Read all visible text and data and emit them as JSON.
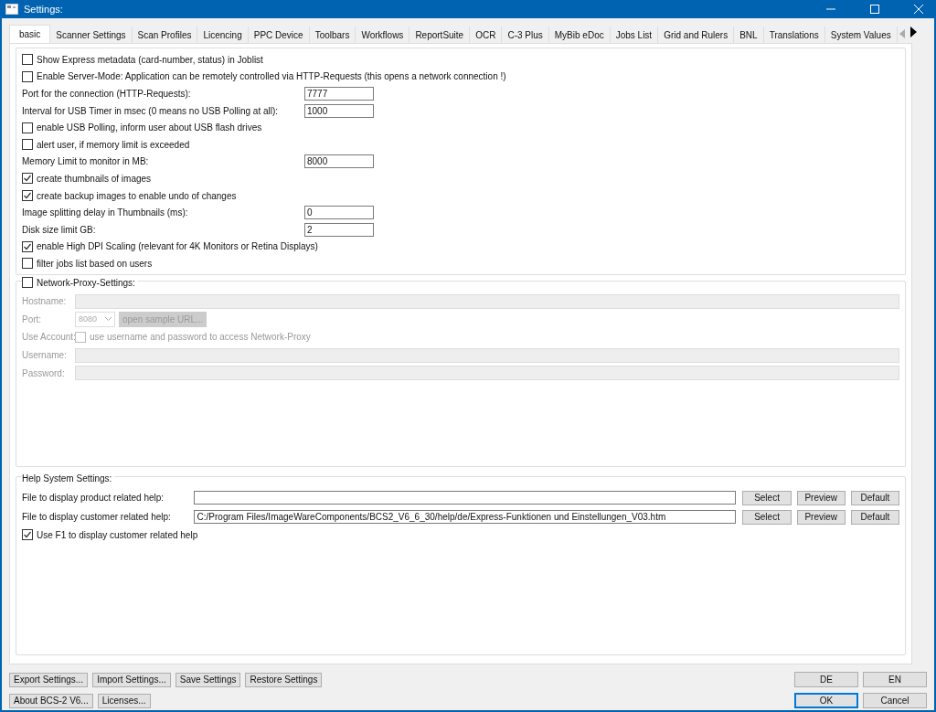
{
  "window": {
    "title": "Settings:"
  },
  "tabs": [
    {
      "label": "basic",
      "selected": true
    },
    {
      "label": "Scanner Settings",
      "selected": false
    },
    {
      "label": "Scan Profiles",
      "selected": false
    },
    {
      "label": "Licencing",
      "selected": false
    },
    {
      "label": "PPC Device",
      "selected": false
    },
    {
      "label": "Toolbars",
      "selected": false
    },
    {
      "label": "Workflows",
      "selected": false
    },
    {
      "label": "ReportSuite",
      "selected": false
    },
    {
      "label": "OCR",
      "selected": false
    },
    {
      "label": "C-3 Plus",
      "selected": false
    },
    {
      "label": "MyBib eDoc",
      "selected": false
    },
    {
      "label": "Jobs List",
      "selected": false
    },
    {
      "label": "Grid and Rulers",
      "selected": false
    },
    {
      "label": "BNL",
      "selected": false
    },
    {
      "label": "Translations",
      "selected": false
    },
    {
      "label": "System Values",
      "selected": false
    }
  ],
  "tab_scroll": {
    "left_disabled": true
  },
  "basic": [
    {
      "kind": "checkbox",
      "label": "Show Express metadata (card-number, status) in Joblist",
      "checked": false
    },
    {
      "kind": "checkbox",
      "label": "Enable Server-Mode: Application can be remotely controlled via HTTP-Requests (this opens a network connection !)",
      "checked": false
    },
    {
      "kind": "field",
      "label": "Port for the connection (HTTP-Requests):",
      "value": "7777"
    },
    {
      "kind": "field",
      "label": "Interval for USB Timer in msec (0 means no USB Polling at all):",
      "value": "1000"
    },
    {
      "kind": "checkbox",
      "label": "enable USB Polling, inform user about USB flash drives",
      "checked": false
    },
    {
      "kind": "checkbox",
      "label": "alert user, if memory limit is exceeded",
      "checked": false
    },
    {
      "kind": "field",
      "label": "Memory Limit to monitor in MB:",
      "value": "8000"
    },
    {
      "kind": "checkbox",
      "label": "create thumbnails of images",
      "checked": true
    },
    {
      "kind": "checkbox",
      "label": "create backup images to enable undo of changes",
      "checked": true
    },
    {
      "kind": "field",
      "label": "Image splitting delay in Thumbnails (ms):",
      "value": "0"
    },
    {
      "kind": "field",
      "label": "Disk size limit GB:",
      "value": "2"
    },
    {
      "kind": "checkbox",
      "label": "enable High DPI Scaling (relevant for 4K Monitors or Retina Displays)",
      "checked": true
    },
    {
      "kind": "checkbox",
      "label": "filter jobs list based on users",
      "checked": false
    }
  ],
  "proxy": {
    "label": "Network-Proxy-Settings:",
    "checked": false,
    "hostname_label": "Hostname:",
    "port_label": "Port:",
    "port_value": "8080",
    "sample_button": "open sample URL...",
    "account_label": "Use Account:",
    "account_checkbox": {
      "label": "use username and password to access Network-Proxy",
      "checked": false
    },
    "username_label": "Username:",
    "password_label": "Password:"
  },
  "help": {
    "title": "Help System Settings:",
    "rows": [
      {
        "label": "File to display product related help:",
        "value": "",
        "buttons": [
          "Select",
          "Preview",
          "Default"
        ]
      },
      {
        "label": "File to display customer related help:",
        "value": "C:/Program Files/ImageWareComponents/BCS2_V6_6_30/help/de/Express-Funktionen und Einstellungen_V03.htm",
        "buttons": [
          "Select",
          "Preview",
          "Default"
        ]
      }
    ],
    "f1": {
      "label": "Use F1 to display customer related help",
      "checked": true
    }
  },
  "footer": {
    "left_top": [
      "Export Settings...",
      "Import Settings...",
      "Save Settings",
      "Restore Settings"
    ],
    "left_bottom": [
      "About BCS-2 V6...",
      "Licenses..."
    ],
    "right_top": [
      "DE",
      "EN"
    ],
    "right_bottom": [
      {
        "label": "OK",
        "default": true
      },
      {
        "label": "Cancel",
        "default": false
      }
    ]
  }
}
